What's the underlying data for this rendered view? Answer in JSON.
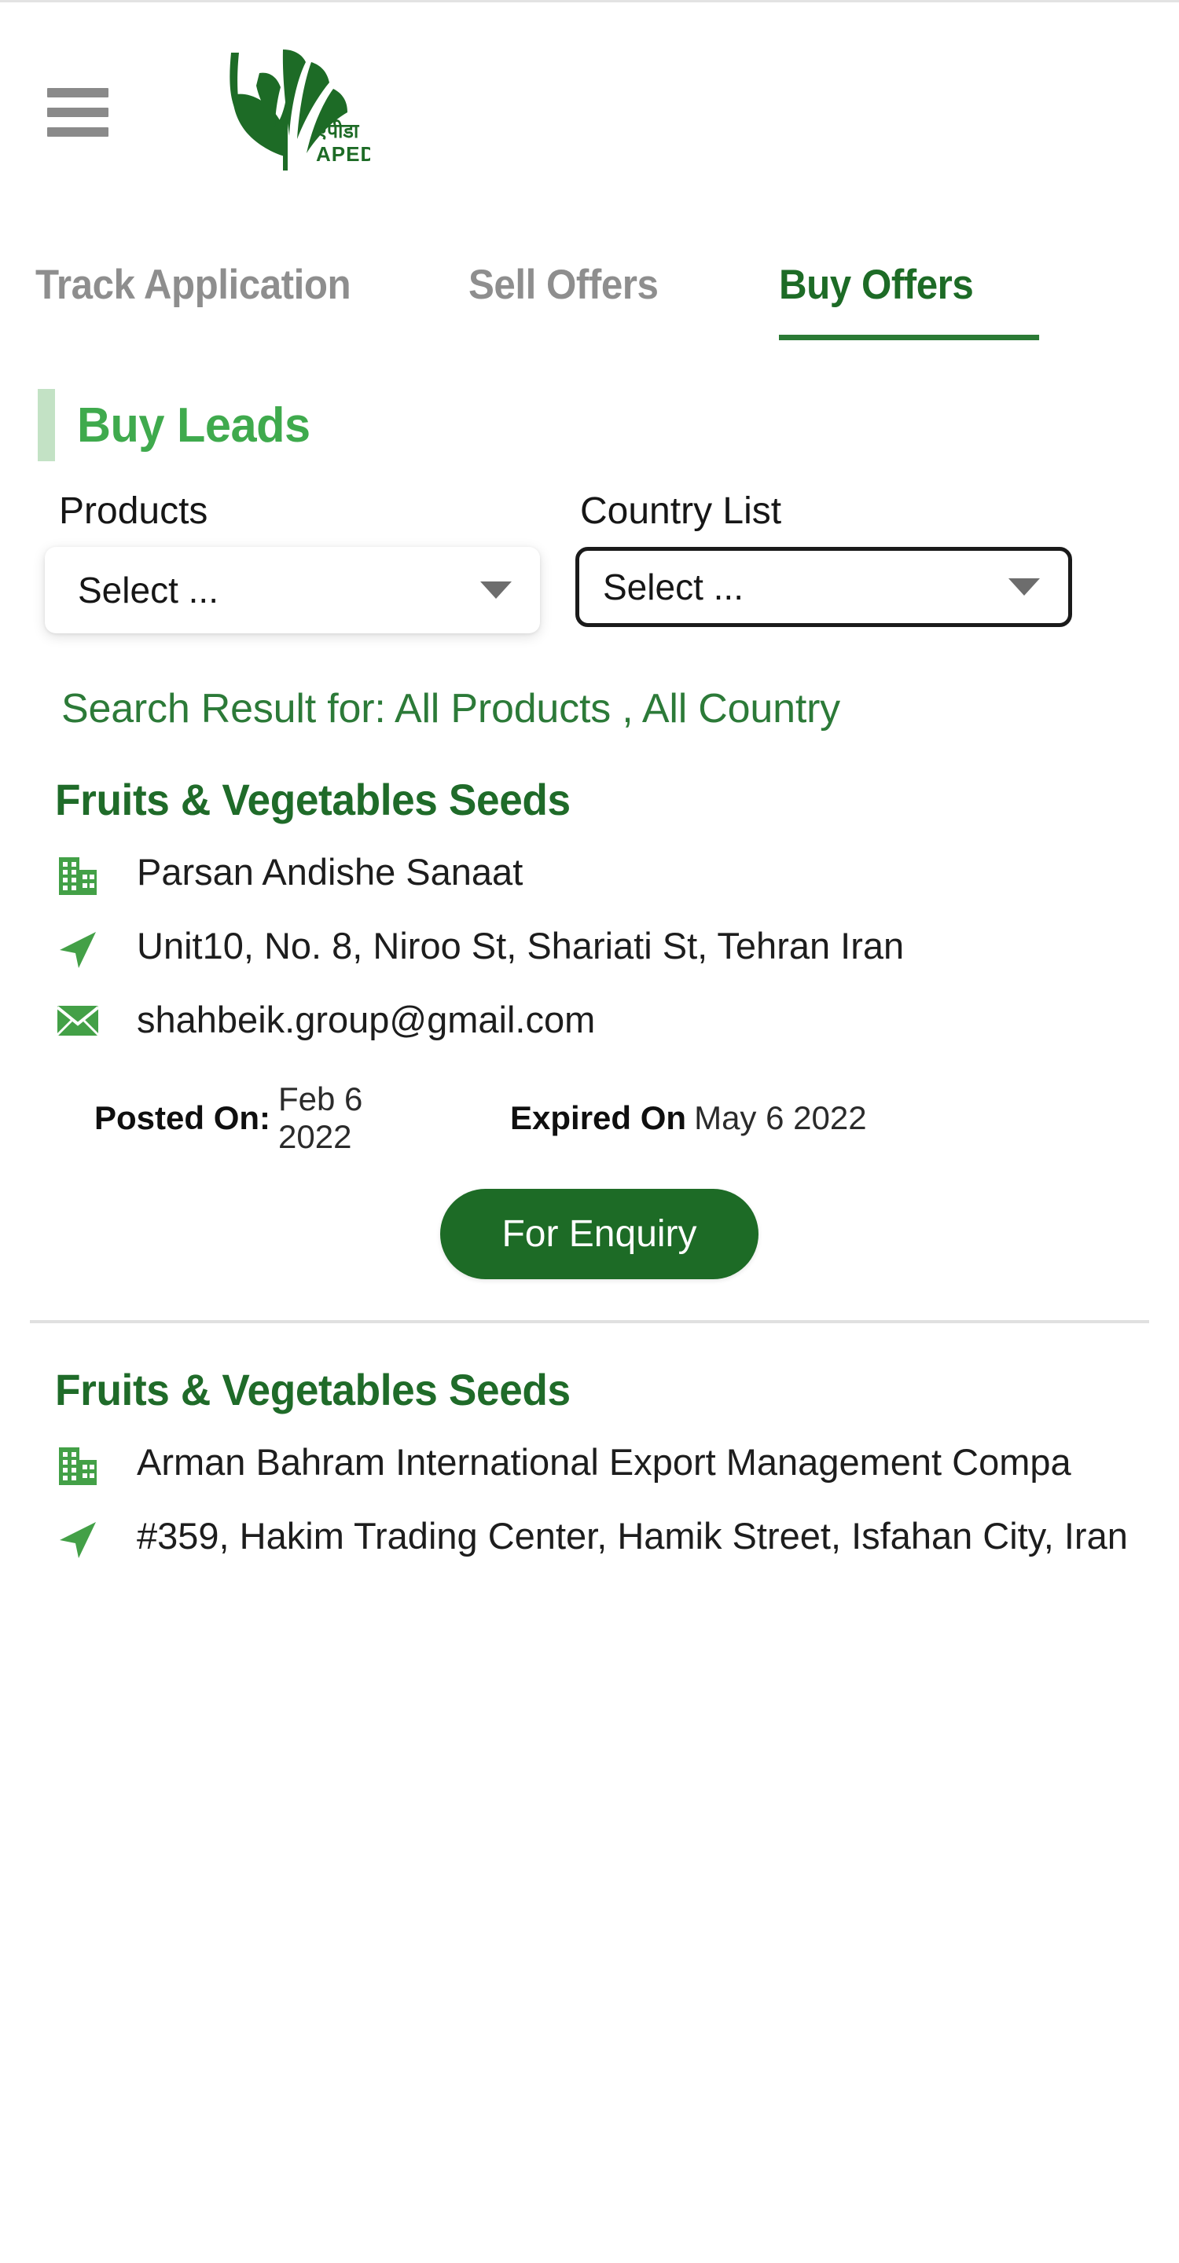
{
  "header": {
    "menu_icon": "hamburger-menu-icon",
    "logo": {
      "icon": "apeda-leaf-logo",
      "hindi_text": "एपीडा",
      "text": "APEDA"
    }
  },
  "tabs": [
    {
      "label": "Track Application",
      "active": false
    },
    {
      "label": "Sell Offers",
      "active": false
    },
    {
      "label": "Buy Offers",
      "active": true
    }
  ],
  "section": {
    "title": "Buy Leads"
  },
  "filters": {
    "products": {
      "label": "Products",
      "value": "Select ...",
      "caret_icon": "chevron-down-icon"
    },
    "country": {
      "label": "Country List",
      "value": "Select ...",
      "caret_icon": "chevron-down-icon"
    }
  },
  "search_result_text": "Search Result for: All Products , All Country",
  "listings": [
    {
      "product": "Fruits & Vegetables Seeds",
      "company": "Parsan Andishe Sanaat",
      "address": "Unit10, No. 8, Niroo St, Shariati St, Tehran Iran",
      "email": "shahbeik.group@gmail.com",
      "posted_label": "Posted On:",
      "posted_value": "Feb  6 2022",
      "expired_label": "Expired On",
      "expired_value": "May  6 2022",
      "enquiry_label": "For Enquiry",
      "icons": {
        "company": "building-icon",
        "address": "location-arrow-icon",
        "email": "envelope-icon"
      }
    },
    {
      "product": "Fruits & Vegetables Seeds",
      "company": "Arman Bahram International Export Management Compa",
      "address": "#359, Hakim Trading Center, Hamik Street, Isfahan City, Iran",
      "icons": {
        "company": "building-icon",
        "address": "location-arrow-icon"
      }
    }
  ],
  "colors": {
    "brand_dark_green": "#1d6b26",
    "brand_green": "#3faa4d",
    "icon_green": "#43a047",
    "accent_bar": "#c3e2c5",
    "muted_gray": "#8e8e8e",
    "divider": "#e0e0e0"
  }
}
